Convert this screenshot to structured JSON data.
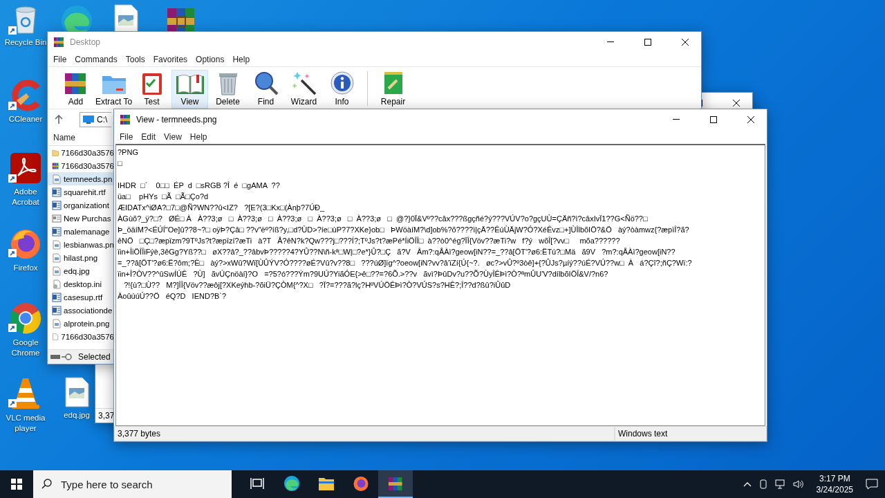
{
  "desktop_icons": [
    {
      "kind": "recycle",
      "label": "Recycle Bin"
    },
    {
      "kind": "edge"
    },
    {
      "kind": "image"
    },
    {
      "kind": "winrar"
    },
    {
      "kind": "ccleaner",
      "label": "CCleaner"
    },
    {
      "kind": "acrobat",
      "label": "Adobe Acrobat"
    },
    {
      "kind": "firefox",
      "label": "Firefox"
    },
    {
      "kind": "chrome",
      "label": "Google Chrome"
    },
    {
      "kind": "vlc",
      "label": "VLC media player"
    },
    {
      "kind": "image",
      "label": "edq.jpg"
    }
  ],
  "back_window": {
    "status": "3,37"
  },
  "winrar": {
    "title": "Desktop",
    "menu": [
      "File",
      "Commands",
      "Tools",
      "Favorites",
      "Options",
      "Help"
    ],
    "toolbar": [
      {
        "kind": "add",
        "label": "Add",
        "selected": false
      },
      {
        "kind": "extract",
        "label": "Extract To",
        "selected": false
      },
      {
        "kind": "test",
        "label": "Test",
        "selected": false
      },
      {
        "kind": "view",
        "label": "View",
        "selected": true
      },
      {
        "kind": "delete",
        "label": "Delete",
        "selected": false
      },
      {
        "kind": "find",
        "label": "Find",
        "selected": false
      },
      {
        "kind": "wizard",
        "label": "Wizard",
        "selected": false
      },
      {
        "kind": "info",
        "label": "Info",
        "selected": false
      },
      {
        "kind": "repair",
        "label": "Repair",
        "selected": false
      }
    ],
    "address": "C:\\",
    "column": "Name",
    "files": [
      {
        "kind": "folder",
        "name": "7166d30a3576",
        "selected": false
      },
      {
        "kind": "rar",
        "name": "7166d30a3576",
        "selected": false
      },
      {
        "kind": "image",
        "name": "termneeds.pn",
        "selected": true
      },
      {
        "kind": "word",
        "name": "squarehit.rtf",
        "selected": false
      },
      {
        "kind": "word",
        "name": "organizationt",
        "selected": false
      },
      {
        "kind": "form",
        "name": "New Purchas",
        "selected": false
      },
      {
        "kind": "word",
        "name": "malemanage",
        "selected": false
      },
      {
        "kind": "image",
        "name": "lesbianwas.pn",
        "selected": false
      },
      {
        "kind": "image",
        "name": "hilast.png",
        "selected": false
      },
      {
        "kind": "image",
        "name": "edq.jpg",
        "selected": false
      },
      {
        "kind": "settings",
        "name": "desktop.ini",
        "selected": false
      },
      {
        "kind": "word",
        "name": "casesup.rtf",
        "selected": false
      },
      {
        "kind": "word",
        "name": "associationde",
        "selected": false
      },
      {
        "kind": "image",
        "name": "alprotein.png",
        "selected": false
      },
      {
        "kind": "blank",
        "name": "7166d30a3576",
        "selected": false
      }
    ],
    "status": "Selected"
  },
  "viewer": {
    "title": "View - termneeds.png",
    "menu": [
      "File",
      "Edit",
      "View",
      "Help"
    ],
    "paragraphs": [
      [
        "?PNG",
        "□"
      ],
      [
        "IHDR  □`    0□□  ÉP  d  □sRGB ?Î  é  □gAMA  ??",
        "üa□    pHYs  □Ã  □Ã□Ço?d",
        "ÆIDATx^iØA?□7□@Ñ?WN??û<IZ?   ?[E?(3□Kx□(Ànþ?7ÚÐ_",
        "ÀGùõ?_ÿ?□?   ØÉ□ À   À??3;ø   □  À??3;ø   □  À??3;ø   □  À??3;ø   □  À??3;ø   □  @?}0Ï&Vº??câx???ßgçñé?ý???VÚV?o?gçUÙ=ÇÄñ?ì?câxIvÏ1??G<Ñö??□",
        "Þ_öäíM?<ÉÚÍ\"Oe]û??8~?□ oÿÞ?Çâ□ ??v\"ëº?íß?y,□d?ÙD>?íe□ùP?7?XKe}ob□   ÞWöàíM?\\d]ob%?õ????ì|çÄ??ÊúÙÄjW?Ó?XéÊvz□+]ÙÎlbõIÖ?&Ö   àý?òàmwz{?æpìÎ?ã?",
        "êNÖ   □Ç□?æpïzm?9TºJs?t?æpïzí?æTi   à?T   Å?êN?k?Qw???j□???Í?;TºJs?t?æPé*ÍiÖÎÎ□  à??ò0^ég?ÏÎ{Vöv??æTi?w   f?ý   wõÎ[?vv□     mõa??????",
        "ïin+ÎiÖÎÎiFýè,3êGg?Yß??□   øX??â?_??âbvÞ?????4?YÛ??N\\ñ-kª□W|□?e*}Û?□Ç   ã?V   Âm?:qÅÀì?geow[iN??=_??â[ÖT'?ø6:ËTú?□Mä   ã9V   ?m?:qÅÀì?geow[iN??",
        "=_??â[ÖT'?ø6:Ë?ôm;?È□   àý?>xWû?Wï[ÙÛÝV?Ó????øÉ?Vû?v??8□   ???úØ]ïg^?oeow[iN?vv?â'ïZí{Ú{~?.   øc?>vÛ?º3òê]+{?ÛJs?µíý??úÉ?VÚ??w□  À   á?Çî?;ñÇ?Wï:?",
        "ïin+Î?ÒV??^ûSwÍÚÊ   ?Ù]   ãvÚÇnöàí}?O   =?5?ó???Ým?9UÚ?YiãÓE{>ê□??=?6Õ.>??v   ãvì?ÞûDv?u??Õ?ÙyÎÊÞì?Ò?ªmÛU'V?dílbõIÖÎ&V/?n6?",
        "   ?!{ù?□Ù??   M?]ÎÎ{Vöv??æôj[?XKeýhb-?õiÜ?ÇÒM{^?X□   ?Ï?=???ã?lç?HºVÚÖÊÞì?Ò?VÚS?s?HÊ?;Î??d?ßû?iÛûD",
        "ÀoûúúÚ??Ö   éQ?D   IEND?B`?"
      ]
    ],
    "size": "3,377 bytes",
    "encoding": "Windows text"
  },
  "taskbar": {
    "search": {
      "placeholder": "Type here to search"
    },
    "apps": [
      {
        "kind": "taskview",
        "selected": false
      },
      {
        "kind": "edge",
        "selected": false
      },
      {
        "kind": "explorer",
        "selected": false
      },
      {
        "kind": "firefox",
        "selected": false
      },
      {
        "kind": "winrar",
        "selected": true
      }
    ],
    "time": "3:17 PM",
    "date": "3/24/2025"
  }
}
